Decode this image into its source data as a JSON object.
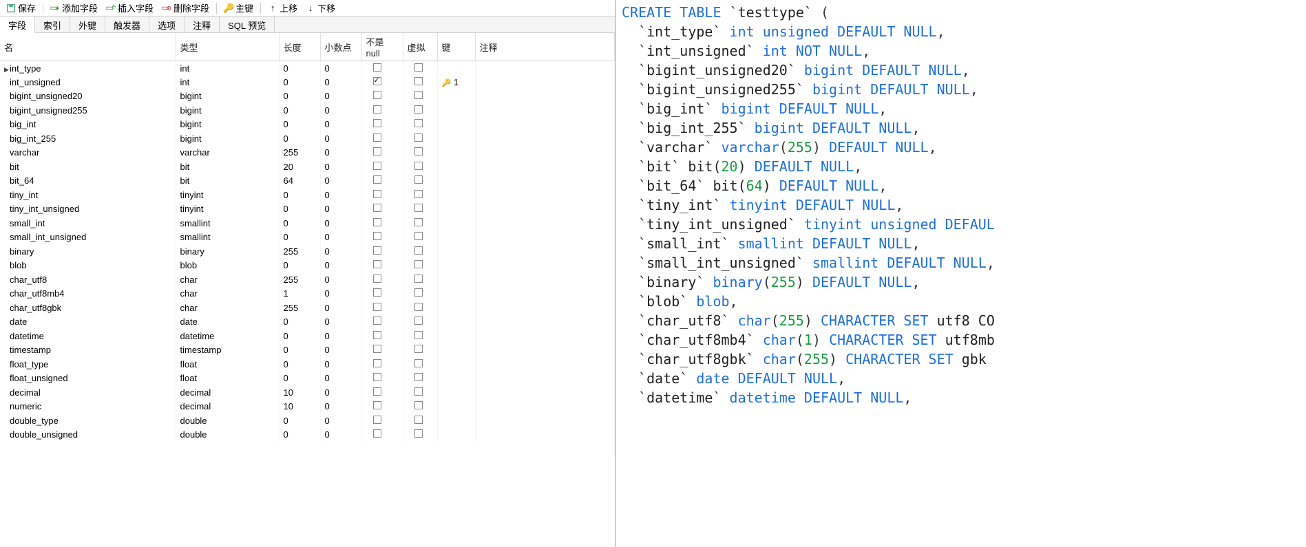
{
  "toolbar": {
    "save": "保存",
    "add_field": "添加字段",
    "insert_field": "插入字段",
    "delete_field": "删除字段",
    "primary_key": "主键",
    "move_up": "上移",
    "move_down": "下移"
  },
  "tabs": [
    "字段",
    "索引",
    "外键",
    "触发器",
    "选项",
    "注释",
    "SQL 预览"
  ],
  "active_tab": 0,
  "columns": {
    "name": "名",
    "type": "类型",
    "length": "长度",
    "decimals": "小数点",
    "not_null": "不是 null",
    "virtual": "虚拟",
    "key": "键",
    "comment": "注释"
  },
  "fields": [
    {
      "name": "int_type",
      "type": "int",
      "length": "0",
      "decimals": "0",
      "not_null": false,
      "virtual": false,
      "key": "",
      "indicator": "▶"
    },
    {
      "name": "int_unsigned",
      "type": "int",
      "length": "0",
      "decimals": "0",
      "not_null": true,
      "virtual": false,
      "key": "1"
    },
    {
      "name": "bigint_unsigned20",
      "type": "bigint",
      "length": "0",
      "decimals": "0",
      "not_null": false,
      "virtual": false,
      "key": ""
    },
    {
      "name": "bigint_unsigned255",
      "type": "bigint",
      "length": "0",
      "decimals": "0",
      "not_null": false,
      "virtual": false,
      "key": ""
    },
    {
      "name": "big_int",
      "type": "bigint",
      "length": "0",
      "decimals": "0",
      "not_null": false,
      "virtual": false,
      "key": ""
    },
    {
      "name": "big_int_255",
      "type": "bigint",
      "length": "0",
      "decimals": "0",
      "not_null": false,
      "virtual": false,
      "key": ""
    },
    {
      "name": "varchar",
      "type": "varchar",
      "length": "255",
      "decimals": "0",
      "not_null": false,
      "virtual": false,
      "key": ""
    },
    {
      "name": "bit",
      "type": "bit",
      "length": "20",
      "decimals": "0",
      "not_null": false,
      "virtual": false,
      "key": ""
    },
    {
      "name": "bit_64",
      "type": "bit",
      "length": "64",
      "decimals": "0",
      "not_null": false,
      "virtual": false,
      "key": ""
    },
    {
      "name": "tiny_int",
      "type": "tinyint",
      "length": "0",
      "decimals": "0",
      "not_null": false,
      "virtual": false,
      "key": ""
    },
    {
      "name": "tiny_int_unsigned",
      "type": "tinyint",
      "length": "0",
      "decimals": "0",
      "not_null": false,
      "virtual": false,
      "key": ""
    },
    {
      "name": "small_int",
      "type": "smallint",
      "length": "0",
      "decimals": "0",
      "not_null": false,
      "virtual": false,
      "key": ""
    },
    {
      "name": "small_int_unsigned",
      "type": "smallint",
      "length": "0",
      "decimals": "0",
      "not_null": false,
      "virtual": false,
      "key": ""
    },
    {
      "name": "binary",
      "type": "binary",
      "length": "255",
      "decimals": "0",
      "not_null": false,
      "virtual": false,
      "key": ""
    },
    {
      "name": "blob",
      "type": "blob",
      "length": "0",
      "decimals": "0",
      "not_null": false,
      "virtual": false,
      "key": ""
    },
    {
      "name": "char_utf8",
      "type": "char",
      "length": "255",
      "decimals": "0",
      "not_null": false,
      "virtual": false,
      "key": ""
    },
    {
      "name": "char_utf8mb4",
      "type": "char",
      "length": "1",
      "decimals": "0",
      "not_null": false,
      "virtual": false,
      "key": ""
    },
    {
      "name": "char_utf8gbk",
      "type": "char",
      "length": "255",
      "decimals": "0",
      "not_null": false,
      "virtual": false,
      "key": ""
    },
    {
      "name": "date",
      "type": "date",
      "length": "0",
      "decimals": "0",
      "not_null": false,
      "virtual": false,
      "key": ""
    },
    {
      "name": "datetime",
      "type": "datetime",
      "length": "0",
      "decimals": "0",
      "not_null": false,
      "virtual": false,
      "key": ""
    },
    {
      "name": "timestamp",
      "type": "timestamp",
      "length": "0",
      "decimals": "0",
      "not_null": false,
      "virtual": false,
      "key": ""
    },
    {
      "name": "float_type",
      "type": "float",
      "length": "0",
      "decimals": "0",
      "not_null": false,
      "virtual": false,
      "key": ""
    },
    {
      "name": "float_unsigned",
      "type": "float",
      "length": "0",
      "decimals": "0",
      "not_null": false,
      "virtual": false,
      "key": ""
    },
    {
      "name": "decimal",
      "type": "decimal",
      "length": "10",
      "decimals": "0",
      "not_null": false,
      "virtual": false,
      "key": ""
    },
    {
      "name": "numeric",
      "type": "decimal",
      "length": "10",
      "decimals": "0",
      "not_null": false,
      "virtual": false,
      "key": ""
    },
    {
      "name": "double_type",
      "type": "double",
      "length": "0",
      "decimals": "0",
      "not_null": false,
      "virtual": false,
      "key": ""
    },
    {
      "name": "double_unsigned",
      "type": "double",
      "length": "0",
      "decimals": "0",
      "not_null": false,
      "virtual": false,
      "key": ""
    }
  ],
  "sql": [
    [
      {
        "t": "CREATE TABLE ",
        "c": "kw"
      },
      {
        "t": "`testtype`",
        "c": "id"
      },
      {
        "t": " (",
        "c": "punc"
      }
    ],
    [
      {
        "t": "  `int_type` ",
        "c": "id"
      },
      {
        "t": "int unsigned DEFAULT NULL",
        "c": "ty"
      },
      {
        "t": ",",
        "c": "punc"
      }
    ],
    [
      {
        "t": "  `int_unsigned` ",
        "c": "id"
      },
      {
        "t": "int NOT NULL",
        "c": "ty"
      },
      {
        "t": ",",
        "c": "punc"
      }
    ],
    [
      {
        "t": "  `bigint_unsigned20` ",
        "c": "id"
      },
      {
        "t": "bigint DEFAULT NULL",
        "c": "ty"
      },
      {
        "t": ",",
        "c": "punc"
      }
    ],
    [
      {
        "t": "  `bigint_unsigned255` ",
        "c": "id"
      },
      {
        "t": "bigint DEFAULT NULL",
        "c": "ty"
      },
      {
        "t": ",",
        "c": "punc"
      }
    ],
    [
      {
        "t": "  `big_int` ",
        "c": "id"
      },
      {
        "t": "bigint DEFAULT NULL",
        "c": "ty"
      },
      {
        "t": ",",
        "c": "punc"
      }
    ],
    [
      {
        "t": "  `big_int_255` ",
        "c": "id"
      },
      {
        "t": "bigint DEFAULT NULL",
        "c": "ty"
      },
      {
        "t": ",",
        "c": "punc"
      }
    ],
    [
      {
        "t": "  `varchar` ",
        "c": "id"
      },
      {
        "t": "varchar",
        "c": "ty"
      },
      {
        "t": "(",
        "c": "punc"
      },
      {
        "t": "255",
        "c": "num"
      },
      {
        "t": ") ",
        "c": "punc"
      },
      {
        "t": "DEFAULT NULL",
        "c": "ty"
      },
      {
        "t": ",",
        "c": "punc"
      }
    ],
    [
      {
        "t": "  `bit` ",
        "c": "id"
      },
      {
        "t": "bit(",
        "c": "id"
      },
      {
        "t": "20",
        "c": "num"
      },
      {
        "t": ") ",
        "c": "id"
      },
      {
        "t": "DEFAULT NULL",
        "c": "ty"
      },
      {
        "t": ",",
        "c": "punc"
      }
    ],
    [
      {
        "t": "  `bit_64` ",
        "c": "id"
      },
      {
        "t": "bit(",
        "c": "id"
      },
      {
        "t": "64",
        "c": "num"
      },
      {
        "t": ") ",
        "c": "id"
      },
      {
        "t": "DEFAULT NULL",
        "c": "ty"
      },
      {
        "t": ",",
        "c": "punc"
      }
    ],
    [
      {
        "t": "  `tiny_int` ",
        "c": "id"
      },
      {
        "t": "tinyint DEFAULT NULL",
        "c": "ty"
      },
      {
        "t": ",",
        "c": "punc"
      }
    ],
    [
      {
        "t": "  `tiny_int_unsigned` ",
        "c": "id"
      },
      {
        "t": "tinyint unsigned DEFAUL",
        "c": "ty"
      }
    ],
    [
      {
        "t": "  `small_int` ",
        "c": "id"
      },
      {
        "t": "smallint DEFAULT NULL",
        "c": "ty"
      },
      {
        "t": ",",
        "c": "punc"
      }
    ],
    [
      {
        "t": "  `small_int_unsigned` ",
        "c": "id"
      },
      {
        "t": "smallint DEFAULT NULL",
        "c": "ty"
      },
      {
        "t": ",",
        "c": "punc"
      }
    ],
    [
      {
        "t": "  `binary` ",
        "c": "id"
      },
      {
        "t": "binary",
        "c": "ty"
      },
      {
        "t": "(",
        "c": "punc"
      },
      {
        "t": "255",
        "c": "num"
      },
      {
        "t": ") ",
        "c": "punc"
      },
      {
        "t": "DEFAULT NULL",
        "c": "ty"
      },
      {
        "t": ",",
        "c": "punc"
      }
    ],
    [
      {
        "t": "  `blob` ",
        "c": "id"
      },
      {
        "t": "blob",
        "c": "ty"
      },
      {
        "t": ",",
        "c": "punc"
      }
    ],
    [
      {
        "t": "  `char_utf8` ",
        "c": "id"
      },
      {
        "t": "char",
        "c": "ty"
      },
      {
        "t": "(",
        "c": "punc"
      },
      {
        "t": "255",
        "c": "num"
      },
      {
        "t": ") ",
        "c": "punc"
      },
      {
        "t": "CHARACTER SET",
        "c": "ty"
      },
      {
        "t": " utf8 CO",
        "c": "id"
      }
    ],
    [
      {
        "t": "  `char_utf8mb4` ",
        "c": "id"
      },
      {
        "t": "char",
        "c": "ty"
      },
      {
        "t": "(",
        "c": "punc"
      },
      {
        "t": "1",
        "c": "num"
      },
      {
        "t": ") ",
        "c": "punc"
      },
      {
        "t": "CHARACTER SET",
        "c": "ty"
      },
      {
        "t": " utf8mb",
        "c": "id"
      }
    ],
    [
      {
        "t": "  `char_utf8gbk` ",
        "c": "id"
      },
      {
        "t": "char",
        "c": "ty"
      },
      {
        "t": "(",
        "c": "punc"
      },
      {
        "t": "255",
        "c": "num"
      },
      {
        "t": ") ",
        "c": "punc"
      },
      {
        "t": "CHARACTER SET",
        "c": "ty"
      },
      {
        "t": " gbk ",
        "c": "id"
      }
    ],
    [
      {
        "t": "  `date` ",
        "c": "id"
      },
      {
        "t": "date DEFAULT NULL",
        "c": "ty"
      },
      {
        "t": ",",
        "c": "punc"
      }
    ],
    [
      {
        "t": "  `datetime` ",
        "c": "id"
      },
      {
        "t": "datetime DEFAULT NULL",
        "c": "ty"
      },
      {
        "t": ",",
        "c": "punc"
      }
    ]
  ]
}
